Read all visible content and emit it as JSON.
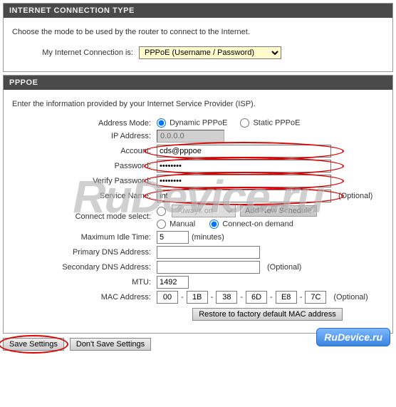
{
  "watermark": "RuDevice.ru",
  "badge": "RuDevice.ru",
  "section1": {
    "title": "INTERNET CONNECTION TYPE",
    "intro": "Choose the mode to be used by the router to connect to the Internet.",
    "conn_label": "My Internet Connection is:",
    "conn_value": "PPPoE (Username / Password)"
  },
  "section2": {
    "title": "PPPOE",
    "intro": "Enter the information provided by your Internet Service Provider (ISP).",
    "addr_mode_label": "Address Mode:",
    "addr_dynamic": "Dynamic PPPoE",
    "addr_static": "Static PPPoE",
    "ip_label": "IP Address:",
    "ip_value": "0.0.0.0",
    "account_label": "Account:",
    "account_value": "cds@pppoe",
    "password_label": "Password:",
    "password_value": "••••••••",
    "verify_label": "Verify Password:",
    "verify_value": "••••••••",
    "service_label": "Service Name:",
    "service_value": "int",
    "service_optional": "(Optional)",
    "connect_mode_label": "Connect mode select:",
    "sched_value": "Always on",
    "sched_btn": "Add New Schedule",
    "mode_manual": "Manual",
    "mode_demand": "Connect-on demand",
    "idle_label": "Maximum Idle Time:",
    "idle_value": "5",
    "idle_unit": "(minutes)",
    "pdns_label": "Primary DNS Address:",
    "sdns_label": "Secondary DNS Address:",
    "sdns_optional": "(Optional)",
    "mtu_label": "MTU:",
    "mtu_value": "1492",
    "mac_label": "MAC Address:",
    "mac": [
      "00",
      "1B",
      "38",
      "6D",
      "E8",
      "7C"
    ],
    "mac_optional": "(Optional)",
    "restore_btn": "Restore to factory default MAC address"
  },
  "footer": {
    "save": "Save Settings",
    "dont_save": "Don't Save Settings"
  }
}
